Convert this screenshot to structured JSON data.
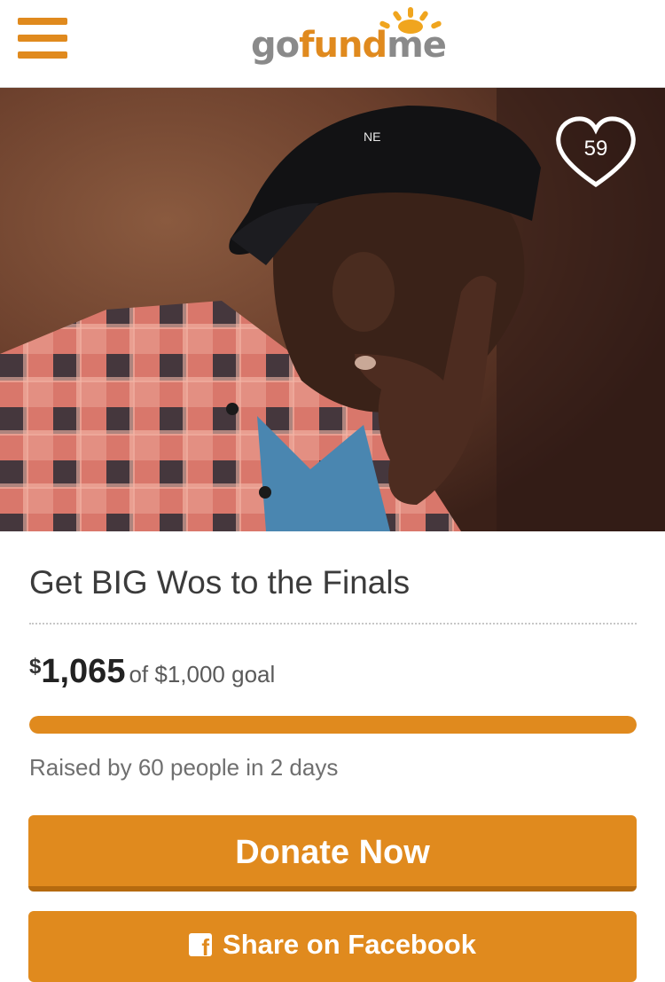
{
  "header": {
    "menu_icon": "hamburger-menu-icon",
    "logo": {
      "part1": "go",
      "part2": "fund",
      "part3": "me"
    }
  },
  "campaign": {
    "image_description_icon": "campaign-photo",
    "likes": "59",
    "title": "Get BIG Wos to the Finals",
    "currency_symbol": "$",
    "raised_amount": "1,065",
    "goal_text": "of $1,000 goal",
    "progress_percent": 100,
    "raised_by": "Raised by 60 people in 2 days"
  },
  "actions": {
    "donate_label": "Donate Now",
    "share_label": "Share on Facebook",
    "share_icon": "facebook-icon"
  },
  "colors": {
    "brand_orange": "#e08a1e",
    "logo_gray": "#8a8a8a"
  }
}
